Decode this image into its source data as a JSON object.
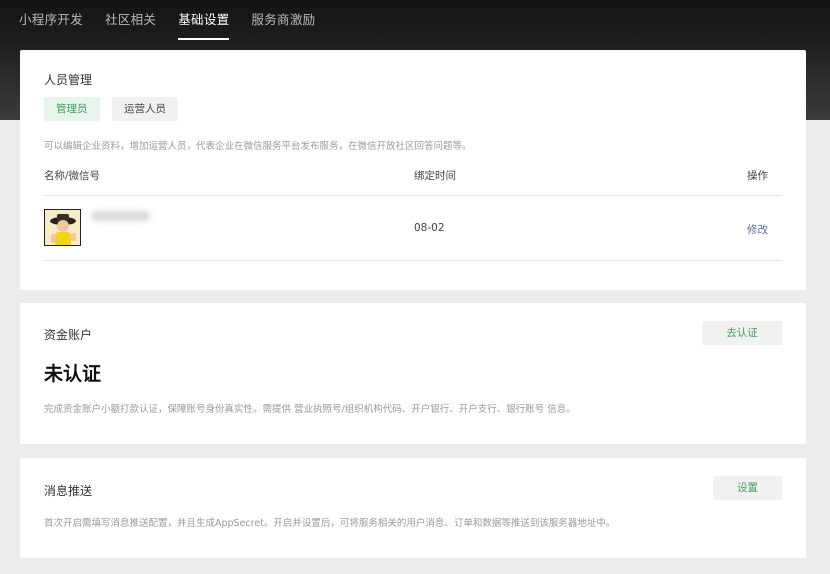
{
  "topnav": {
    "items": [
      {
        "label": "小程序开发"
      },
      {
        "label": "社区相关"
      },
      {
        "label": "基础设置",
        "active": true
      },
      {
        "label": "服务商激励"
      }
    ]
  },
  "personnel": {
    "title": "人员管理",
    "tabs": [
      {
        "label": "管理员",
        "active": true
      },
      {
        "label": "运营人员"
      }
    ],
    "description": "可以编辑企业资料，增加运营人员，代表企业在微信服务平台发布服务，在微信开放社区回答问题等。",
    "table": {
      "headers": {
        "name": "名称/微信号",
        "time": "绑定时间",
        "action": "操作"
      },
      "rows": [
        {
          "bind_time": "08-02",
          "action": "修改"
        }
      ]
    }
  },
  "fund_account": {
    "title": "资金账户",
    "button": "去认证",
    "status": "未认证",
    "description": "完成资金账户小额打款认证，保障账号身份真实性。需提供 营业执照号/组织机构代码、开户银行、开户支行、银行账号 信息。"
  },
  "message_push": {
    "title": "消息推送",
    "button": "设置",
    "description": "首次开启需填写消息推送配置，并且生成AppSecret。开启并设置后，可将服务相关的用户消息、订单和数据等推送到该服务器地址中。"
  },
  "colors": {
    "accent_green": "#3fa05f",
    "link_blue": "#566d9e",
    "topbar_dark": "#141414"
  }
}
